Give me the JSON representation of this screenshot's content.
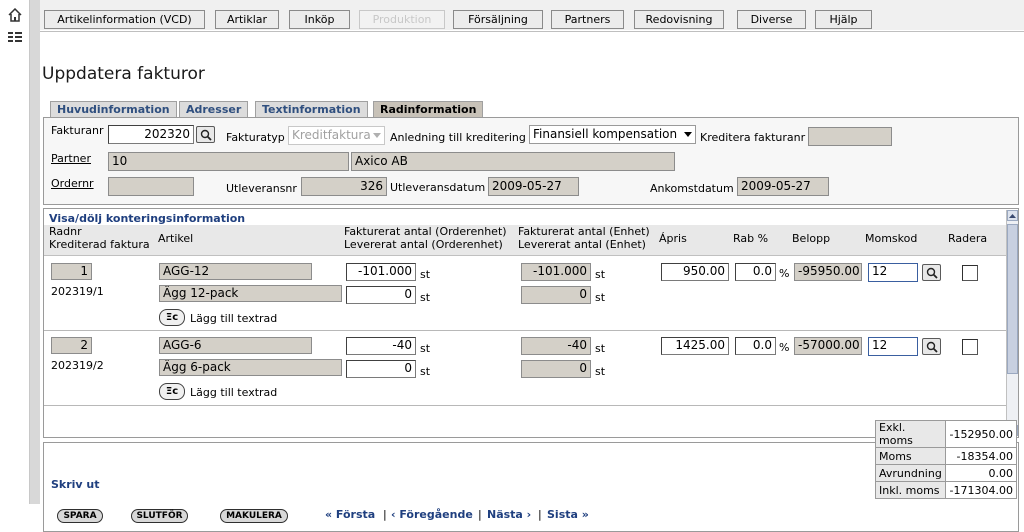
{
  "nav": {
    "tabs": [
      {
        "label": "Artikelinformation (VCD)",
        "enabled": true
      },
      {
        "label": "Artiklar",
        "enabled": true
      },
      {
        "label": "Inköp",
        "enabled": true
      },
      {
        "label": "Produktion",
        "enabled": false
      },
      {
        "label": "Försäljning",
        "enabled": true
      },
      {
        "label": "Partners",
        "enabled": true
      },
      {
        "label": "Redovisning",
        "enabled": true
      },
      {
        "label": "Diverse",
        "enabled": true
      },
      {
        "label": "Hjälp",
        "enabled": true
      }
    ]
  },
  "page": {
    "title": "Uppdatera fakturor"
  },
  "subtabs": [
    {
      "label": "Huvudinformation",
      "active": false
    },
    {
      "label": "Adresser",
      "active": false
    },
    {
      "label": "Textinformation",
      "active": false
    },
    {
      "label": "Radinformation",
      "active": true
    }
  ],
  "header": {
    "fakturanr_label": "Fakturanr",
    "fakturanr": "202320",
    "fakturatyp_label": "Fakturatyp",
    "fakturatyp": "Kreditfaktura",
    "anledning_label": "Anledning till kreditering",
    "anledning": "Finansiell kompensation",
    "kreditera_label": "Kreditera fakturanr",
    "kreditera": "",
    "partner_label": "Partner",
    "partner_id": "10",
    "partner_name": "Axico AB",
    "ordernr_label": "Ordernr",
    "ordernr": "",
    "utleveransnr_label": "Utleveransnr",
    "utleveransnr": "326",
    "utleveransdatum_label": "Utleveransdatum",
    "utleveransdatum": "2009-05-27",
    "ankomstdatum_label": "Ankomstdatum",
    "ankomstdatum": "2009-05-27"
  },
  "rows": {
    "toggle_label": "Visa/dölj konteringsinformation",
    "columns": {
      "radnr": "Radnr",
      "krediterad": "Krediterad faktura",
      "artikel": "Artikel",
      "fakt_order": "Fakturerat antal (Orderenhet)",
      "lev_order": "Levererat antal (Orderenhet)",
      "fakt_enhet": "Fakturerat antal (Enhet)",
      "lev_enhet": "Levererat antal (Enhet)",
      "apris": "Ápris",
      "rab": "Rab %",
      "belopp": "Belopp",
      "momskod": "Momskod",
      "radera": "Radera"
    },
    "unit": "st",
    "percent": "%",
    "add_text": "Lägg till textrad",
    "add_icon": "Ξc",
    "items": [
      {
        "radnr": "1",
        "ref": "202319/1",
        "artikel": "AGG-12",
        "benamning": "Ägg 12-pack",
        "fakt_order": "-101.000",
        "lev_order": "0",
        "fakt_enhet": "-101.000",
        "lev_enhet": "0",
        "apris": "950.00",
        "rab": "0.0",
        "belopp": "-95950.00",
        "moms": "12"
      },
      {
        "radnr": "2",
        "ref": "202319/2",
        "artikel": "AGG-6",
        "benamning": "Ägg 6-pack",
        "fakt_order": "-40",
        "lev_order": "0",
        "fakt_enhet": "-40",
        "lev_enhet": "0",
        "apris": "1425.00",
        "rab": "0.0",
        "belopp": "-57000.00",
        "moms": "12"
      }
    ]
  },
  "footer": {
    "print": "Skriv ut",
    "buttons": {
      "spara": "SPARA",
      "slutfor": "SLUTFÖR",
      "makulera": "MAKULERA"
    },
    "pager": {
      "first": "« Första",
      "prev": "‹ Föregående",
      "next": "Nästa ›",
      "last": "Sista »",
      "sep": "|"
    },
    "summary": [
      {
        "label": "Exkl. moms",
        "value": "-152950.00"
      },
      {
        "label": "Moms",
        "value": "-18354.00"
      },
      {
        "label": "Avrundning",
        "value": "0.00"
      },
      {
        "label": "Inkl. moms",
        "value": "-171304.00"
      }
    ]
  }
}
